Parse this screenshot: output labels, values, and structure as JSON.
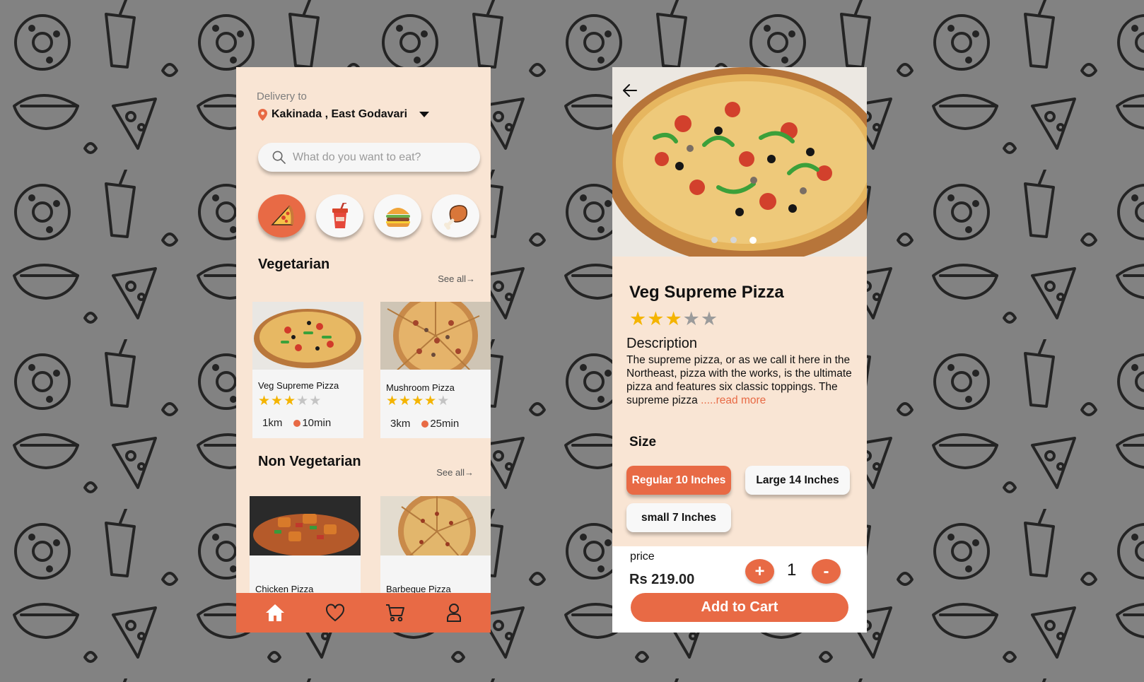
{
  "home": {
    "delivery_label": "Delivery to",
    "location": "Kakinada , East Godavari",
    "search_placeholder": "What do you want to eat?",
    "categories": [
      {
        "icon": "pizza-icon",
        "active": true
      },
      {
        "icon": "drink-icon",
        "active": false
      },
      {
        "icon": "burger-icon",
        "active": false
      },
      {
        "icon": "chicken-leg-icon",
        "active": false
      }
    ],
    "vegetarian": {
      "title": "Vegetarian",
      "see_all": "See all→",
      "items": [
        {
          "name": "Veg Supreme Pizza",
          "rating": 3,
          "distance": "1km",
          "time": "10min"
        },
        {
          "name": "Mushroom Pizza",
          "rating": 4,
          "distance": "3km",
          "time": "25min"
        }
      ]
    },
    "non_vegetarian": {
      "title": "Non Vegetarian",
      "see_all": "See all→",
      "items": [
        {
          "name": "Chicken Pizza"
        },
        {
          "name": "Barbeque Pizza"
        }
      ]
    },
    "nav": [
      "home-icon",
      "heart-icon",
      "cart-icon",
      "profile-icon"
    ]
  },
  "detail": {
    "title": "Veg Supreme Pizza",
    "rating": 3,
    "description_heading": "Description",
    "description": "The supreme pizza, or as we call it here in the Northeast, pizza with the works, is the ultimate pizza and features six classic toppings. The supreme pizza ",
    "read_more": ".....read more",
    "size_heading": "Size",
    "sizes": [
      "Regular 10 Inches",
      "Large 14 Inches",
      "small 7 Inches"
    ],
    "selected_size": "Regular 10 Inches",
    "price_label": "price",
    "price": "Rs 219.00",
    "plus": "+",
    "quantity": "1",
    "minus": "-",
    "add_to_cart": "Add to Cart"
  },
  "colors": {
    "accent": "#e86a45",
    "cream": "#f9e5d4",
    "star": "#f4b400",
    "background": "#828282"
  }
}
